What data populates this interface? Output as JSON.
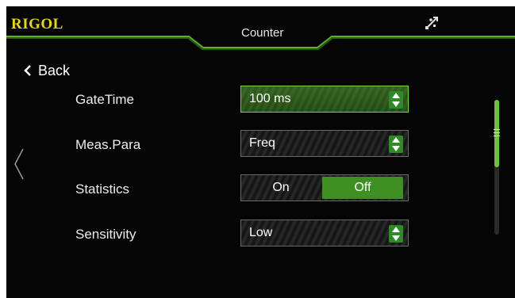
{
  "header": {
    "brand": "RIGOL",
    "title": "Counter",
    "usb_icon": "usb-icon"
  },
  "nav": {
    "back_label": "Back"
  },
  "settings": [
    {
      "key": "gate_time",
      "label": "GateTime",
      "value": "100 ms"
    },
    {
      "key": "meas_para",
      "label": "Meas.Para",
      "value": "Freq"
    },
    {
      "key": "statistics",
      "label": "Statistics",
      "options": [
        "On",
        "Off"
      ],
      "selected": "Off"
    },
    {
      "key": "sensitivity",
      "label": "Sensitivity",
      "value": "Low"
    }
  ],
  "colors": {
    "accent_green": "#6cc43a",
    "brand_yellow": "#e6d800",
    "background": "#050505"
  },
  "scroll": {
    "position_fraction": 0.5
  }
}
